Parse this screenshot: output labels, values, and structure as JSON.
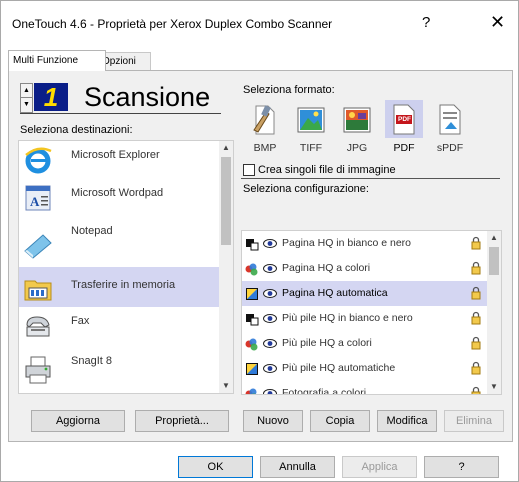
{
  "window": {
    "title": "OneTouch 4.6 - Proprietà per Xerox Duplex Combo Scanner",
    "help": "?",
    "close": "✕"
  },
  "tabs": [
    {
      "label": "Multi Funzione"
    },
    {
      "label": "Opzioni"
    }
  ],
  "header": {
    "lcd_number": "1",
    "title": "Scansione"
  },
  "destinations": {
    "label": "Seleziona destinazioni:",
    "items": [
      {
        "label": "Microsoft Explorer",
        "icon": "internet-explorer-icon"
      },
      {
        "label": "Microsoft Wordpad",
        "icon": "wordpad-icon"
      },
      {
        "label": "Notepad",
        "icon": "notepad-icon"
      },
      {
        "label": "Trasferire in memoria",
        "icon": "transfer-memory-icon",
        "selected": true
      },
      {
        "label": "Fax",
        "icon": "fax-icon"
      },
      {
        "label": "SnagIt 8",
        "icon": "printer-icon"
      }
    ]
  },
  "formats": {
    "label": "Seleziona formato:",
    "items": [
      {
        "label": "BMP",
        "icon": "bmp-icon"
      },
      {
        "label": "TIFF",
        "icon": "tiff-icon"
      },
      {
        "label": "JPG",
        "icon": "jpg-icon"
      },
      {
        "label": "PDF",
        "icon": "pdf-icon",
        "selected": true
      },
      {
        "label": "sPDF",
        "icon": "spdf-icon"
      }
    ],
    "pdf_badge": "PDF",
    "single_files_label": "Crea singoli file di immagine",
    "single_files_checked": false
  },
  "configurations": {
    "label": "Seleziona configurazione:",
    "items": [
      {
        "label": "Pagina HQ in bianco e nero",
        "icon": "bw-scan-icon"
      },
      {
        "label": "Pagina HQ a colori",
        "icon": "color-scan-icon"
      },
      {
        "label": "Pagina HQ automatica",
        "icon": "auto-scan-icon",
        "selected": true
      },
      {
        "label": "Più pile  HQ in bianco e nero",
        "icon": "bw-scan-icon"
      },
      {
        "label": "Più pile  HQ a colori",
        "icon": "color-scan-icon"
      },
      {
        "label": "Più pile  HQ automatiche",
        "icon": "auto-scan-icon"
      },
      {
        "label": "Fotografia a colori",
        "icon": "color-scan-icon"
      }
    ]
  },
  "buttons": {
    "refresh": "Aggiorna",
    "properties": "Proprietà...",
    "new": "Nuovo",
    "copy": "Copia",
    "edit": "Modifica",
    "delete": "Elimina",
    "ok": "OK",
    "cancel": "Annulla",
    "apply": "Applica",
    "help": "?"
  }
}
